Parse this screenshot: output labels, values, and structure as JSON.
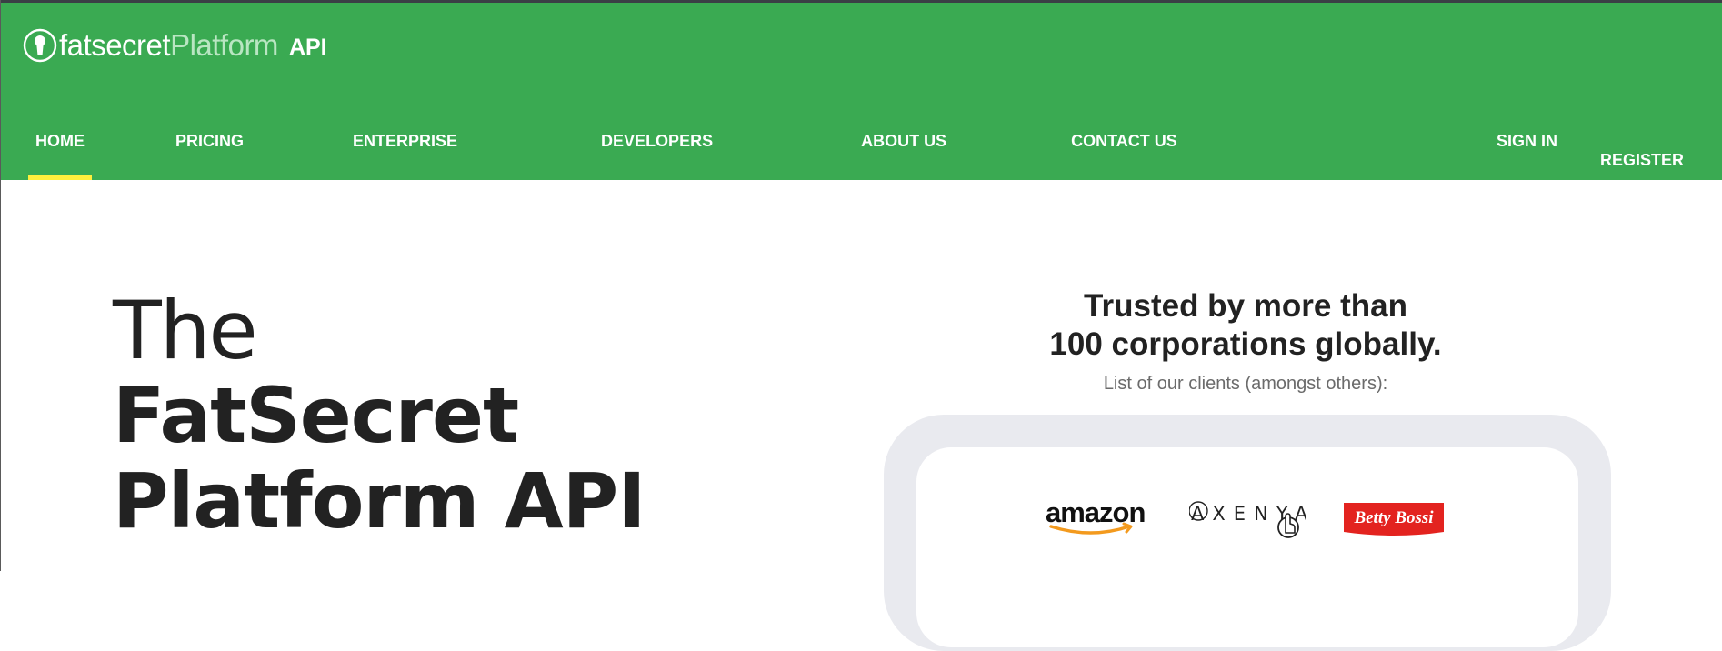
{
  "brand": {
    "name_primary": "fatsecret",
    "name_secondary": "Platform",
    "name_api": "API",
    "icon": "keyhole-logo-icon"
  },
  "nav": {
    "items": [
      {
        "label": "HOME",
        "active": true
      },
      {
        "label": "PRICING"
      },
      {
        "label": "ENTERPRISE"
      },
      {
        "label": "DEVELOPERS"
      },
      {
        "label": "ABOUT US"
      },
      {
        "label": "CONTACT US"
      }
    ],
    "right": [
      {
        "label": "SIGN IN"
      },
      {
        "label": "REGISTER"
      }
    ]
  },
  "hero": {
    "line1": "The",
    "line2": "FatSecret",
    "line3": "Platform API"
  },
  "trust": {
    "heading_line1": "Trusted by more than",
    "heading_line2": "100 corporations globally.",
    "subheading": "List of our clients (amongst others):",
    "clients": [
      {
        "name": "amazon"
      },
      {
        "name": "AXENYA"
      },
      {
        "name": "Betty Bossi"
      }
    ]
  },
  "colors": {
    "header_green": "#3aaa52",
    "active_underline": "#ffef3d",
    "panel_gray": "#e9eaef",
    "betty_red": "#e3231f",
    "amazon_orange": "#f39a1e"
  }
}
